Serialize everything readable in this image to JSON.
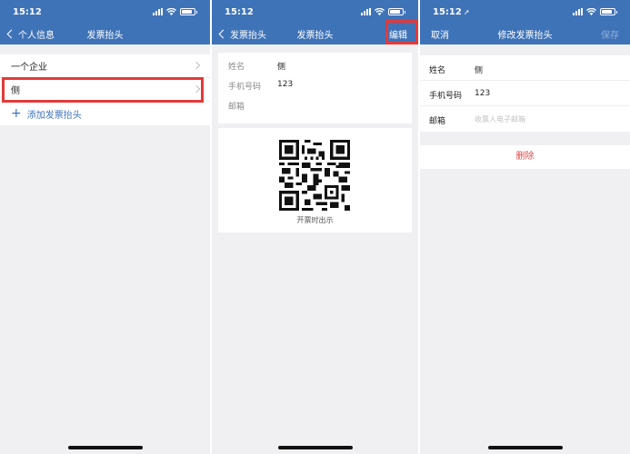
{
  "status": {
    "time": "15:12"
  },
  "screen1": {
    "back_label": "个人信息",
    "title": "发票抬头",
    "items": [
      {
        "label": "一个企业"
      },
      {
        "label": "侧"
      }
    ],
    "add_label": "添加发票抬头"
  },
  "screen2": {
    "back_label": "发票抬头",
    "title": "发票抬头",
    "edit_label": "编辑",
    "fields": [
      {
        "key": "姓名",
        "value": "侧"
      },
      {
        "key": "手机号码",
        "value": "123"
      },
      {
        "key": "邮箱",
        "value": ""
      }
    ],
    "qr_caption": "开票时出示"
  },
  "screen3": {
    "cancel_label": "取消",
    "title": "修改发票抬头",
    "save_label": "保存",
    "fields": [
      {
        "key": "姓名",
        "value": "侧"
      },
      {
        "key": "手机号码",
        "value": "123"
      },
      {
        "key": "邮箱",
        "value": "",
        "placeholder": "收票人电子邮箱"
      }
    ],
    "delete_label": "删除"
  },
  "colors": {
    "nav": "#3f73b8",
    "highlight": "#e23a3a",
    "delete": "#e04848",
    "link": "#3f73b8"
  },
  "icons": [
    "chevron-left-icon",
    "chevron-right-icon",
    "plus-icon",
    "signal-icon",
    "wifi-icon",
    "battery-icon",
    "location-arrow-icon",
    "qr-code"
  ]
}
